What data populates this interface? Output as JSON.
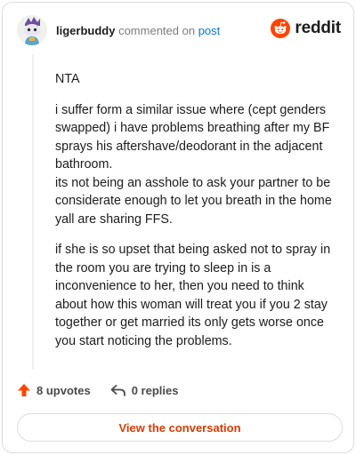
{
  "header": {
    "username": "ligerbuddy",
    "verb": "commented on",
    "link_text": "post",
    "brand": "reddit"
  },
  "comment": {
    "paragraphs": [
      "NTA",
      "i suffer form a similar issue where (cept genders swapped) i have problems breathing after my BF sprays his aftershave/deodorant in the adjacent bathroom.\nits not being an asshole to ask your partner to be considerate enough to let you breath in the home yall are sharing FFS.",
      "if she is so upset that being asked not to spray in the room you are trying to sleep in is a inconvenience to her, then you need to think about how this woman will treat you if you 2 stay together or get married its only gets worse once you start noticing the problems."
    ]
  },
  "actions": {
    "upvotes": "8 upvotes",
    "replies": "0 replies"
  },
  "cta": {
    "label": "View the conversation"
  },
  "colors": {
    "brand": "#ff4500",
    "upvote": "#ff4500",
    "link": "#0079d3",
    "cta_text": "#d93a00"
  },
  "icons": {
    "avatar": "snoo-avatar",
    "brand": "reddit-logo-icon",
    "upvote": "upvote-arrow-icon",
    "reply": "reply-arrow-icon"
  }
}
